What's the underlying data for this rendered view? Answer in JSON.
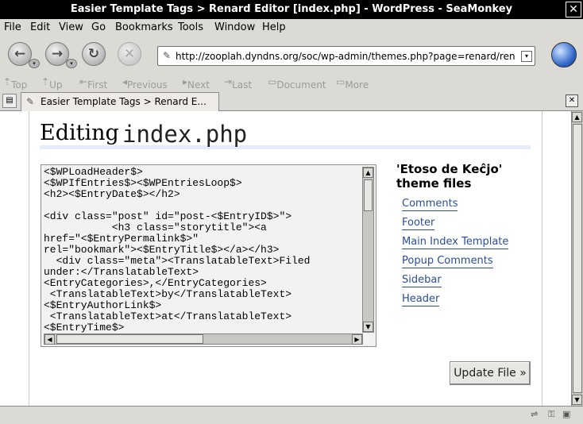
{
  "window": {
    "title": "Easier Template Tags > Renard Editor [index.php] - WordPress - SeaMonkey",
    "close": "✕"
  },
  "menu": [
    "File",
    "Edit",
    "View",
    "Go",
    "Bookmarks",
    "Tools",
    "Window",
    "Help"
  ],
  "nav": {
    "back": "back-arrow-icon",
    "forward": "forward-arrow-icon",
    "reload": "reload-icon",
    "stop": "stop-icon",
    "url": "http://zooplah.dyndns.org/soc/wp-admin/themes.php?page=renard/ren"
  },
  "linkbar": [
    "Top",
    "Up",
    "First",
    "Previous",
    "Next",
    "Last",
    "Document",
    "More"
  ],
  "tab": {
    "label": "Easier Template Tags > Renard E..."
  },
  "page": {
    "heading_editing": "Editing",
    "heading_file": "index.php",
    "code": "<$WPLoadHeader$>\n<$WPIfEntries$><$WPEntriesLoop$>\n<h2><$EntryDate$></h2>\n\n<div class=\"post\" id=\"post-<$EntryID$>\">\n           <h3 class=\"storytitle\"><a\nhref=\"<$EntryPermalink$>\"\nrel=\"bookmark\"><$EntryTitle$></a></h3>\n  <div class=\"meta\"><TranslatableText>Filed\nunder:</TranslatableText>\n<EntryCategories>,</EntryCategories>\n <TranslatableText>by</TranslatableText>\n<$EntryAuthorLink$>\n <TranslatableText>at</TranslatableText>\n<$EntryTime$>",
    "sidebar_title": "'Etoso de Keĉjo' theme files",
    "files": [
      "Comments",
      "Footer",
      "Main Index Template",
      "Popup Comments",
      "Sidebar",
      "Header"
    ],
    "update_button": "Update File »"
  }
}
